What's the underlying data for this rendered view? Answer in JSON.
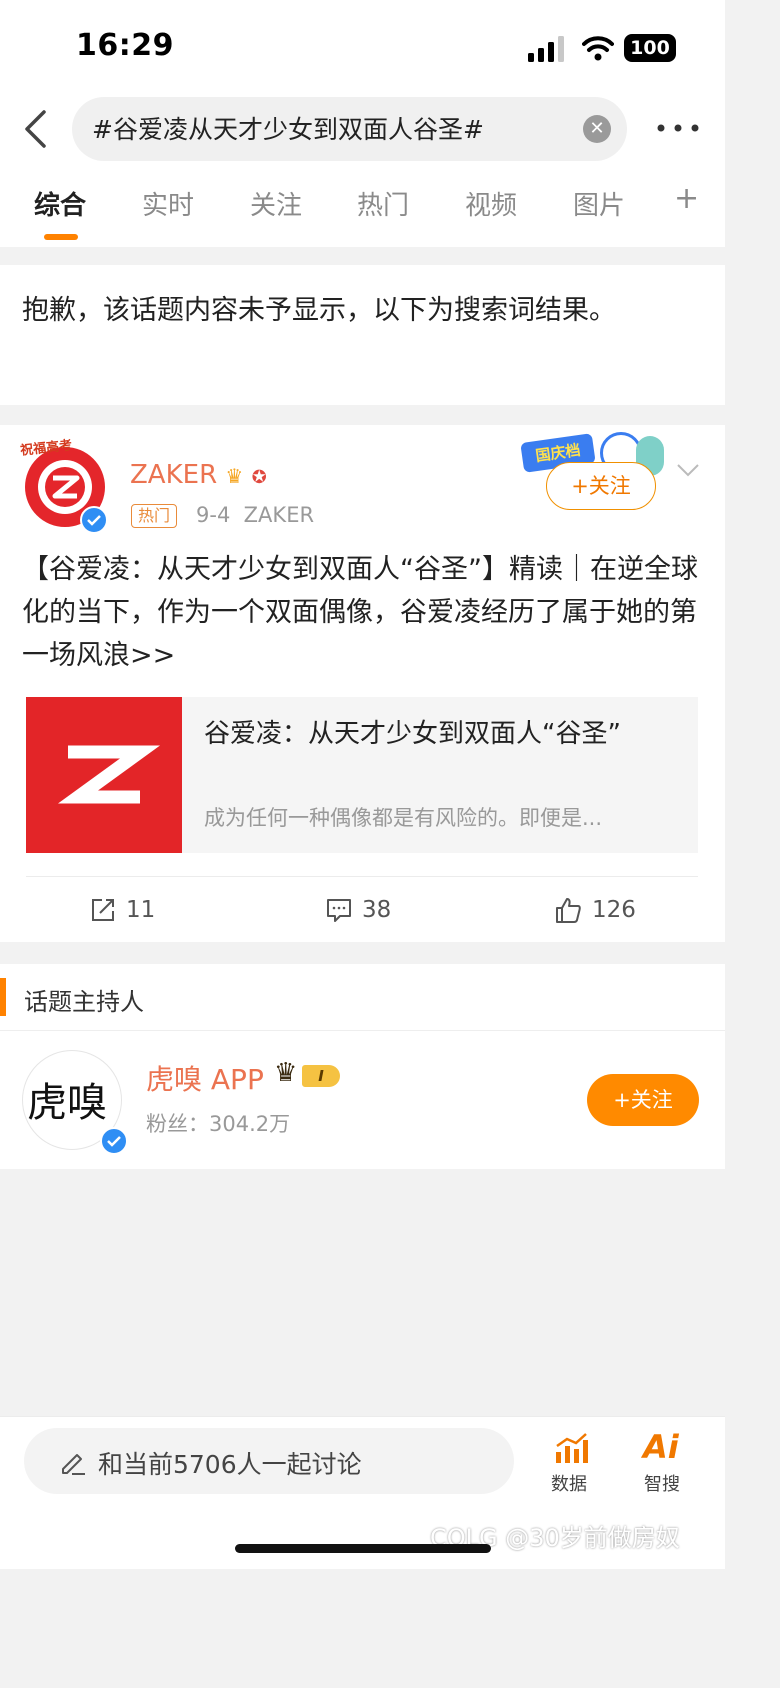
{
  "status_bar": {
    "time": "16:29",
    "battery": "100"
  },
  "header": {
    "search_query": "#谷爱凌从天才少女到双面人谷圣#",
    "tabs": [
      {
        "label": "综合",
        "active": true
      },
      {
        "label": "实时"
      },
      {
        "label": "关注"
      },
      {
        "label": "热门"
      },
      {
        "label": "视频"
      },
      {
        "label": "图片"
      }
    ],
    "add_tab": "+"
  },
  "notice": "抱歉，该话题内容未予显示，以下为搜索词结果。",
  "post": {
    "author": "ZAKER",
    "avatar_badge": "祝福高考",
    "hot_tag": "热门",
    "date": "9-4",
    "source": "ZAKER",
    "promo": "国庆档",
    "follow_label": "+关注",
    "text": "【谷爱凌：从天才少女到双面人“谷圣”】精读｜在逆全球化的当下，作为一个双面偶像，谷爱凌经历了属于她的第一场风浪>>",
    "link_card": {
      "title": "谷爱凌：从天才少女到双面人“谷圣”",
      "description": "成为任何一种偶像都是有风险的。即便是..."
    },
    "reposts": "11",
    "comments": "38",
    "likes": "126"
  },
  "host": {
    "section_title": "话题主持人",
    "name": "虎嗅 APP",
    "avatar_text": "虎嗅",
    "level": "I",
    "fans": "粉丝：304.2万",
    "follow_label": "+关注"
  },
  "bottom_bar": {
    "discuss_placeholder": "和当前5706人一起讨论",
    "data_label": "数据",
    "ai_icon": "Ai",
    "ai_label": "智搜"
  },
  "watermark": "COLG @30岁前做房奴",
  "colors": {
    "accent": "#ff8200",
    "author": "#eb7350",
    "zaker_red": "#e32528",
    "verified": "#2f8ef4"
  }
}
